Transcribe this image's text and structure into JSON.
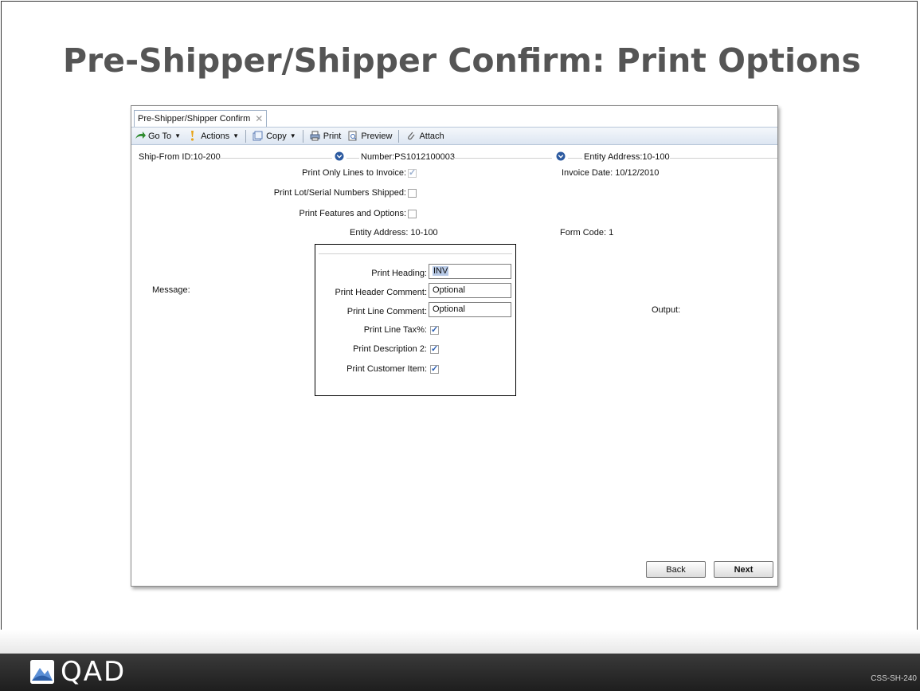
{
  "slide": {
    "title": "Pre-Shipper/Shipper Confirm: Print Options",
    "footer_logo": "QAD",
    "slide_code": "CSS-SH-240"
  },
  "tab": {
    "label": "Pre-Shipper/Shipper Confirm",
    "close_glyph": "✕"
  },
  "toolbar": {
    "goto": "Go To",
    "actions": "Actions",
    "copy": "Copy",
    "print": "Print",
    "preview": "Preview",
    "attach": "Attach"
  },
  "header": {
    "ship_from": "Ship-From ID:10-200",
    "number": "Number:PS1012100003",
    "entity": "Entity Address:10-100"
  },
  "form": {
    "print_only_lines_label": "Print Only Lines to Invoice:",
    "print_only_lines_checked": true,
    "invoice_date": "Invoice Date:  10/12/2010",
    "print_lot_label": "Print Lot/Serial Numbers Shipped:",
    "print_lot_checked": false,
    "print_features_label": "Print Features and Options:",
    "print_features_checked": false,
    "entity_address": "Entity Address:  10-100",
    "form_code": "Form Code:  1",
    "message_label": "Message:",
    "output_label": "Output:"
  },
  "dialog": {
    "print_heading_label": "Print Heading:",
    "print_heading_value": "INV",
    "header_comment_label": "Print Header Comment:",
    "header_comment_value": "Optional",
    "line_comment_label": "Print Line Comment:",
    "line_comment_value": "Optional",
    "line_tax_label": "Print Line Tax%:",
    "line_tax_checked": true,
    "desc2_label": "Print Description 2:",
    "desc2_checked": true,
    "cust_item_label": "Print Customer Item:",
    "cust_item_checked": true
  },
  "buttons": {
    "back": "Back",
    "next": "Next"
  },
  "colors": {
    "toolbar_bg": "#dde6f2",
    "footer_bg": "#2a2a2a",
    "title_text": "#555555"
  },
  "icons": [
    "goto-arrow-icon",
    "actions-icon",
    "copy-icon",
    "print-icon",
    "preview-icon",
    "attach-icon",
    "expand-down-icon",
    "qad-logo-icon"
  ]
}
